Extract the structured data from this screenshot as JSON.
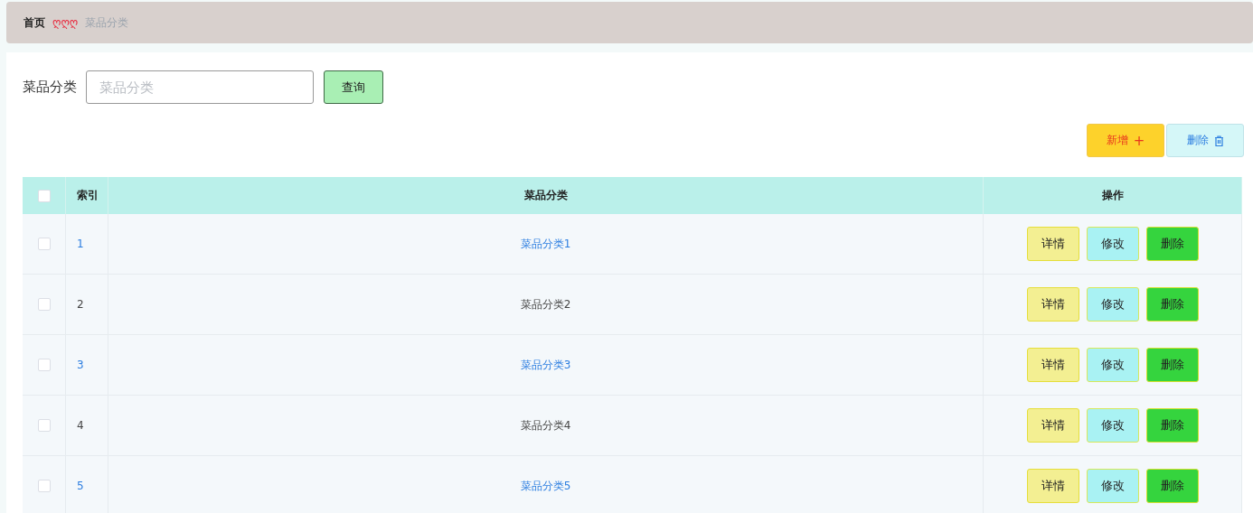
{
  "breadcrumb": {
    "home": "首页",
    "separator": "ღღღ",
    "current": "菜品分类"
  },
  "search": {
    "label": "菜品分类",
    "placeholder": "菜品分类",
    "button": "查询"
  },
  "actions": [
    {
      "kind": "add",
      "label": "新增",
      "icon": "+"
    },
    {
      "kind": "delete",
      "label": "删除"
    }
  ],
  "table": {
    "columns": [
      "索引",
      "菜品分类",
      "操作"
    ],
    "header_checked": false,
    "rows": [
      {
        "checked": false,
        "highlighted": true,
        "index": "1",
        "category": "菜品分类1",
        "buttons": [
          "详情",
          "修改",
          "删除"
        ]
      },
      {
        "checked": false,
        "highlighted": false,
        "index": "2",
        "category": "菜品分类2",
        "buttons": [
          "详情",
          "修改",
          "删除"
        ]
      },
      {
        "checked": false,
        "highlighted": true,
        "index": "3",
        "category": "菜品分类3",
        "buttons": [
          "详情",
          "修改",
          "删除"
        ]
      },
      {
        "checked": false,
        "highlighted": false,
        "index": "4",
        "category": "菜品分类4",
        "buttons": [
          "详情",
          "修改",
          "删除"
        ]
      },
      {
        "checked": false,
        "highlighted": true,
        "index": "5",
        "category": "菜品分类5",
        "buttons": [
          "详情",
          "修改",
          "删除"
        ]
      }
    ]
  }
}
